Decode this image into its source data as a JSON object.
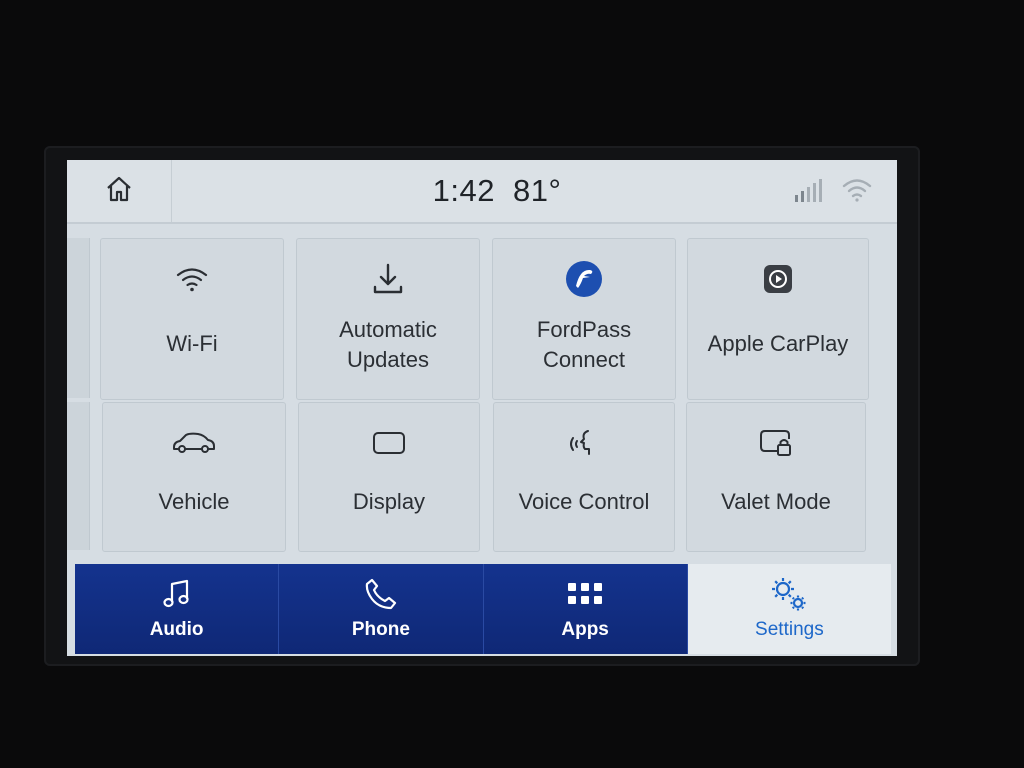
{
  "status": {
    "time": "1:42",
    "temperature": "81°",
    "icons": [
      "home-icon",
      "signal-bars-icon",
      "wifi-icon"
    ]
  },
  "tiles": [
    {
      "label_line1": "Wi-Fi",
      "label_line2": "",
      "icon": "wifi-icon"
    },
    {
      "label_line1": "Automatic",
      "label_line2": "Updates",
      "icon": "download-icon"
    },
    {
      "label_line1": "FordPass",
      "label_line2": "Connect",
      "icon": "fordpass-icon"
    },
    {
      "label_line1": "Apple CarPlay",
      "label_line2": "",
      "icon": "carplay-icon"
    },
    {
      "label_line1": "Vehicle",
      "label_line2": "",
      "icon": "car-icon"
    },
    {
      "label_line1": "Display",
      "label_line2": "",
      "icon": "display-icon"
    },
    {
      "label_line1": "Voice Control",
      "label_line2": "",
      "icon": "voice-icon"
    },
    {
      "label_line1": "Valet Mode",
      "label_line2": "",
      "icon": "valet-lock-icon"
    }
  ],
  "pagination": {
    "pages": 2,
    "current": 2
  },
  "nav": [
    {
      "label": "Audio",
      "icon": "music-note-icon",
      "active": false
    },
    {
      "label": "Phone",
      "icon": "phone-icon",
      "active": false
    },
    {
      "label": "Apps",
      "icon": "apps-grid-icon",
      "active": false
    },
    {
      "label": "Settings",
      "icon": "gears-icon",
      "active": true
    }
  ],
  "colors": {
    "nav_background": "#14338e",
    "active_accent": "#1d67c9",
    "screen_background": "#d6dde3"
  }
}
